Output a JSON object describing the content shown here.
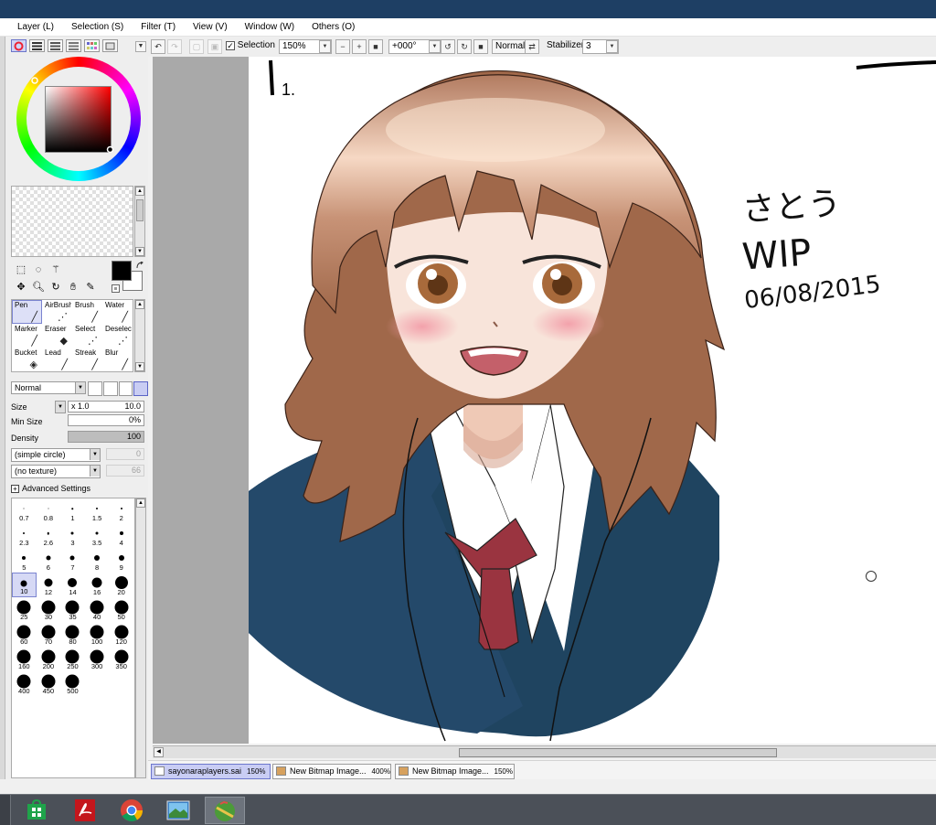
{
  "menu": [
    "Layer (L)",
    "Selection (S)",
    "Filter (T)",
    "View (V)",
    "Window (W)",
    "Others (O)"
  ],
  "toolbar": {
    "selection_label": "Selection",
    "zoom": "150%",
    "rotation": "+000°",
    "blend_mode": "Normal",
    "stabilizer_label": "Stabilizer",
    "stabilizer_value": "3"
  },
  "tools": [
    {
      "label": "Pen",
      "icon": "pen-icon"
    },
    {
      "label": "AirBrush",
      "icon": "airbrush-icon"
    },
    {
      "label": "Brush",
      "icon": "brush-icon"
    },
    {
      "label": "Water",
      "icon": "water-icon"
    },
    {
      "label": "Marker",
      "icon": "marker-icon"
    },
    {
      "label": "Eraser",
      "icon": "eraser-icon"
    },
    {
      "label": "Select",
      "icon": "select-icon"
    },
    {
      "label": "Deselect",
      "icon": "deselect-icon"
    },
    {
      "label": "Bucket",
      "icon": "bucket-icon"
    },
    {
      "label": "Lead",
      "icon": "lead-icon"
    },
    {
      "label": "Streak",
      "icon": "streak-icon"
    },
    {
      "label": "Blur",
      "icon": "blur-icon"
    }
  ],
  "brush": {
    "blend": "Normal",
    "size_label": "Size",
    "size_mult": "x 1.0",
    "size_value": "10.0",
    "min_size_label": "Min Size",
    "min_size_value": "0%",
    "density_label": "Density",
    "density_value": "100",
    "shape": "(simple circle)",
    "shape_value": "0",
    "texture": "(no texture)",
    "texture_value": "66",
    "advanced_label": "Advanced Settings"
  },
  "brush_sizes": [
    "0.7",
    "0.8",
    "1",
    "1.5",
    "2",
    "2.3",
    "2.6",
    "3",
    "3.5",
    "4",
    "5",
    "6",
    "7",
    "8",
    "9",
    "10",
    "12",
    "14",
    "16",
    "20",
    "25",
    "30",
    "35",
    "40",
    "50",
    "60",
    "70",
    "80",
    "100",
    "120",
    "160",
    "200",
    "250",
    "300",
    "350",
    "400",
    "450",
    "500"
  ],
  "brush_size_selected": "10",
  "canvas_text": {
    "number": "1.",
    "name": "さとう",
    "status": "WIP",
    "date": "06/08/2015"
  },
  "file_tabs": [
    {
      "name": "sayonaraplayers.sai",
      "zoom": "150%"
    },
    {
      "name": "New Bitmap Image...",
      "zoom": "400%"
    },
    {
      "name": "New Bitmap Image...",
      "zoom": "150%"
    }
  ],
  "taskbar_apps": [
    "windows-store-icon",
    "adobe-reader-icon",
    "chrome-icon",
    "photo-viewer-icon",
    "paint-tool-sai-icon"
  ],
  "colors": {
    "primary": "#000000",
    "secondary": "#ffffff",
    "hair": "#a0684a",
    "blazer": "#1f4460",
    "tie": "#9a3440",
    "skin": "#f8e4da"
  }
}
